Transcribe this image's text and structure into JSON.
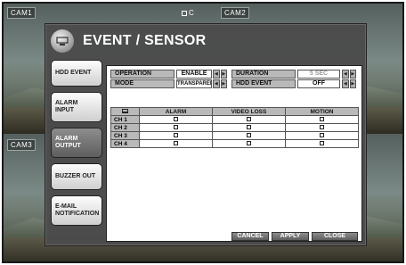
{
  "cameras": [
    {
      "label": "CAM1"
    },
    {
      "label": "CAM2"
    },
    {
      "label": "CAM3"
    }
  ],
  "status": {
    "rec_label": "C"
  },
  "dialog": {
    "title": "EVENT / SENSOR",
    "icon": "sensor-settings-icon"
  },
  "sidebar": {
    "items": [
      {
        "label": "HDD EVENT",
        "active": false
      },
      {
        "label": "ALARM INPUT",
        "active": false
      },
      {
        "label": "ALARM OUTPUT",
        "active": true
      },
      {
        "label": "BUZZER OUT",
        "active": false
      },
      {
        "label": "E-MAIL NOTIFICATION",
        "active": false
      }
    ]
  },
  "settings": {
    "operation": {
      "label": "OPERATION",
      "value": "ENABLE"
    },
    "mode": {
      "label": "MODE",
      "value": "TRANSPARENT"
    },
    "duration": {
      "label": "DURATION",
      "value": "5 SEC"
    },
    "hdd_event": {
      "label": "HDD EVENT",
      "value": "OFF"
    }
  },
  "grid": {
    "columns": [
      "ALARM",
      "VIDEO LOSS",
      "MOTION"
    ],
    "rows": [
      "CH 1",
      "CH 2",
      "CH 3",
      "CH 4"
    ]
  },
  "buttons": {
    "cancel": "CANCEL",
    "apply": "APPLY",
    "close": "CLOSE"
  },
  "colors": {
    "dialog_bg": "#4b4b4b",
    "label_bg": "#b9b9b9",
    "active_tab": "#6e6e6e"
  }
}
